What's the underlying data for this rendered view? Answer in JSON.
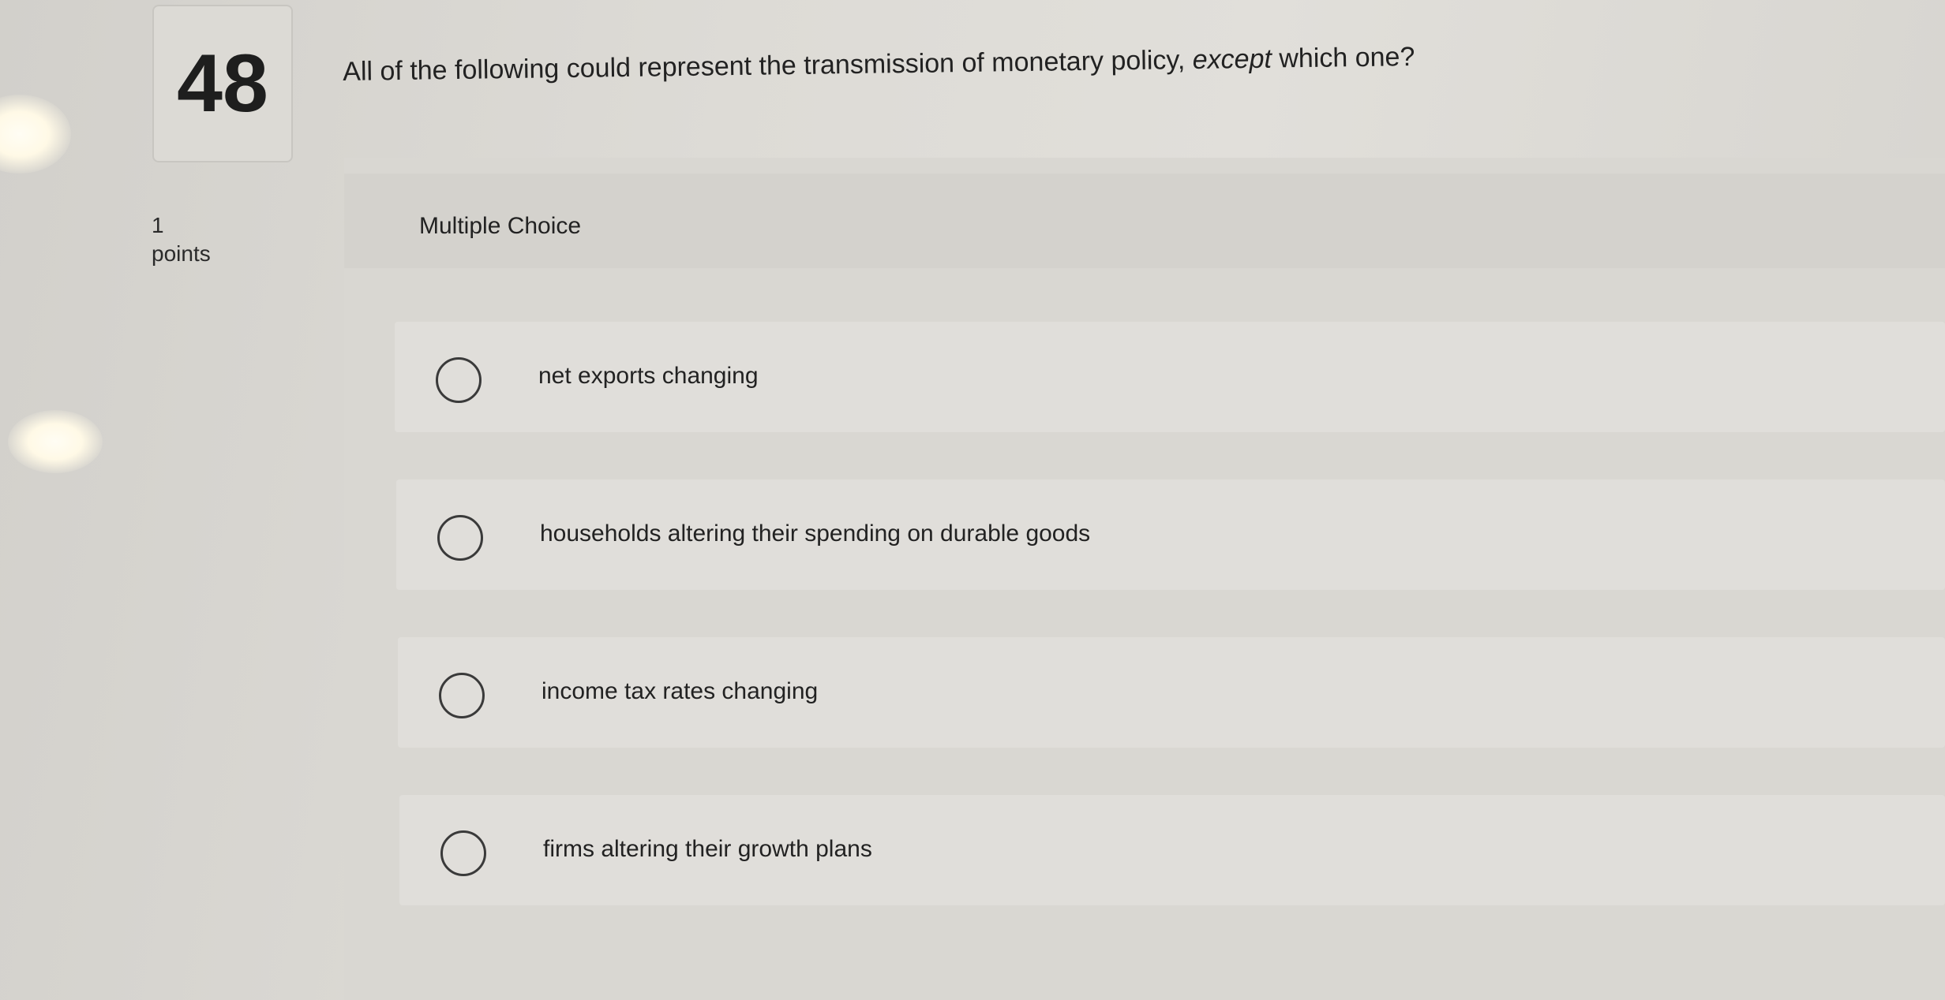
{
  "question": {
    "number": "48",
    "text_before": "All of the following could represent the transmission of monetary policy, ",
    "text_emphasis": "except",
    "text_after": " which one?",
    "points_value": "1",
    "points_label": "points"
  },
  "section": {
    "title": "Multiple Choice"
  },
  "options": [
    {
      "label": "net exports changing"
    },
    {
      "label": "households altering their spending on durable goods"
    },
    {
      "label": "income tax rates changing"
    },
    {
      "label": "firms altering their growth plans"
    }
  ]
}
